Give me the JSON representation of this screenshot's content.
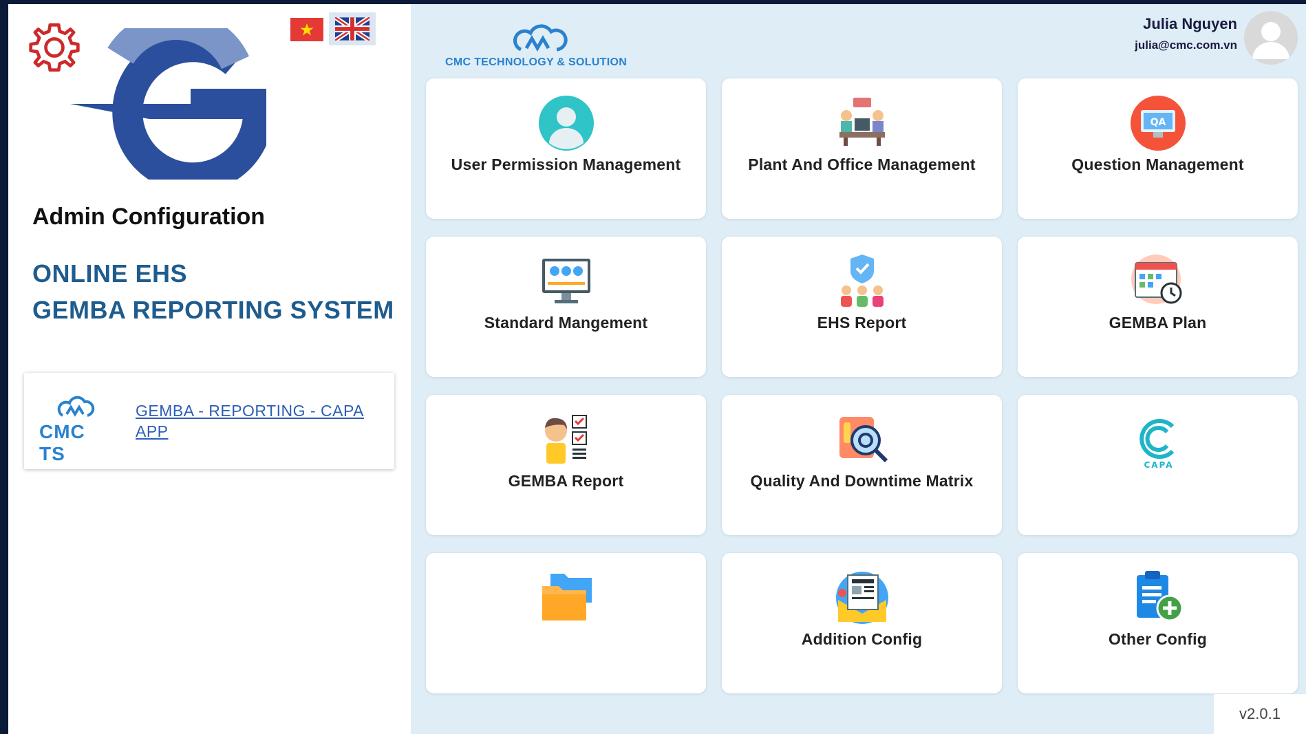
{
  "sidebar": {
    "page_title": "Admin Configuration",
    "system_title_line1": "ONLINE EHS",
    "system_title_line2": "GEMBA REPORTING SYSTEM",
    "app_card": {
      "logo_text": "CMC TS",
      "link_text": "GEMBA - REPORTING - CAPA APP"
    }
  },
  "header": {
    "brand_text": "CMC TECHNOLOGY & SOLUTION",
    "user_name": "Julia Nguyen",
    "user_email": "julia@cmc.com.vn"
  },
  "tiles": [
    {
      "label": "User Permission Management",
      "icon": "user-icon"
    },
    {
      "label": "Plant And Office Management",
      "icon": "office-meeting-icon"
    },
    {
      "label": "Question Management",
      "icon": "qa-monitor-icon"
    },
    {
      "label": "Standard Mangement",
      "icon": "dashboard-monitor-icon"
    },
    {
      "label": "EHS Report",
      "icon": "shield-team-icon"
    },
    {
      "label": "GEMBA Plan",
      "icon": "calendar-clock-icon"
    },
    {
      "label": "GEMBA Report",
      "icon": "checklist-person-icon"
    },
    {
      "label": "Quality And Downtime Matrix",
      "icon": "magnifier-gear-icon"
    },
    {
      "label": "",
      "icon": "capa-logo-icon",
      "logo_text": "CAPA"
    },
    {
      "label": "",
      "icon": "folder-icon"
    },
    {
      "label": "Addition Config",
      "icon": "newsletter-icon"
    },
    {
      "label": "Other Config",
      "icon": "clipboard-add-icon"
    }
  ],
  "footer": {
    "version": "v2.0.1"
  },
  "colors": {
    "accent": "#1f5c8e",
    "brand_blue": "#2a82cf",
    "main_bg": "#deedf6",
    "gear_red": "#cc2a2a"
  }
}
